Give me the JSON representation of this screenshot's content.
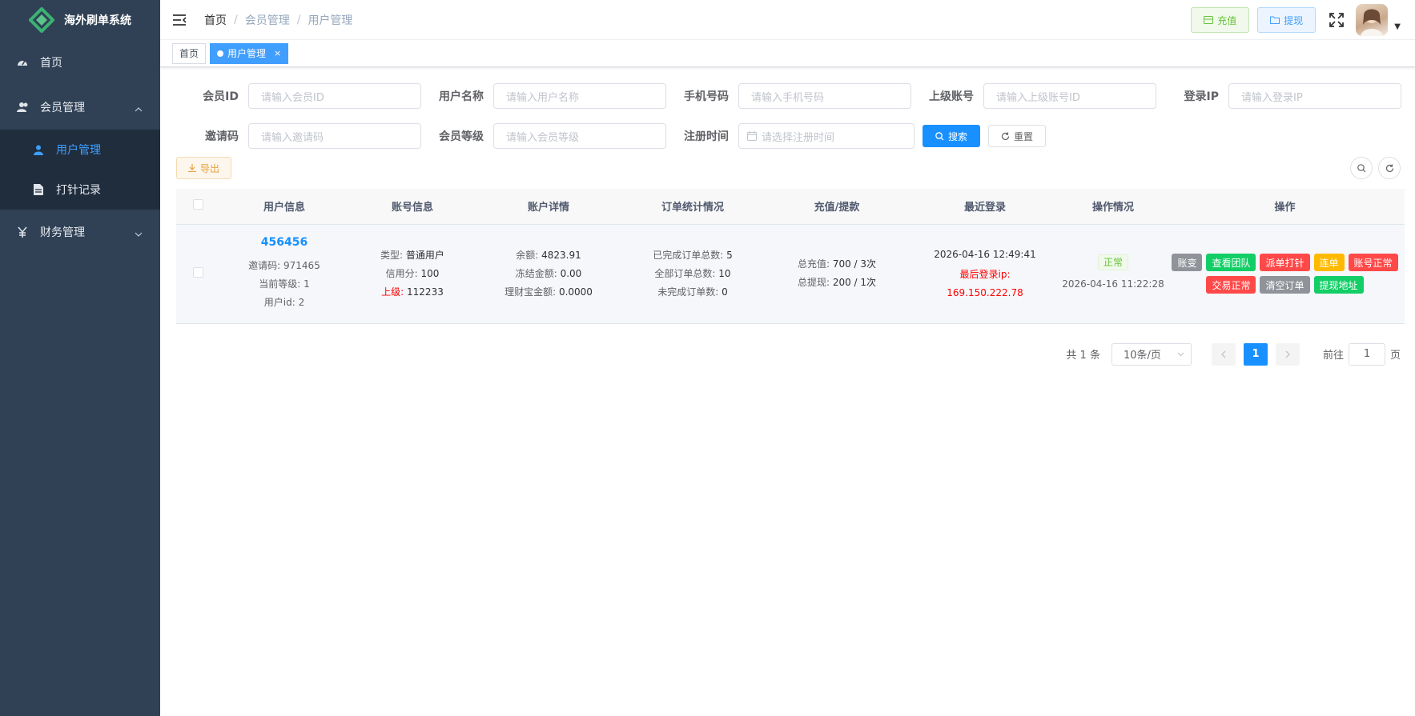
{
  "sidebar": {
    "logo_text": "海外刷单系统",
    "items": [
      {
        "label": "首页",
        "icon": "dashboard-icon"
      },
      {
        "label": "会员管理",
        "icon": "user-group-icon",
        "expanded": true,
        "children": [
          {
            "label": "用户管理",
            "icon": "user-icon",
            "active": true
          },
          {
            "label": "打针记录",
            "icon": "document-icon"
          }
        ]
      },
      {
        "label": "财务管理",
        "icon": "yen-icon"
      }
    ]
  },
  "navbar": {
    "breadcrumb": [
      "首页",
      "会员管理",
      "用户管理"
    ],
    "recharge_label": "充值",
    "withdraw_label": "提现"
  },
  "tags": [
    {
      "label": "首页"
    },
    {
      "label": "用户管理",
      "active": true,
      "close": "×"
    }
  ],
  "search": {
    "fields": [
      {
        "label": "会员ID",
        "placeholder": "请输入会员ID"
      },
      {
        "label": "用户名称",
        "placeholder": "请输入用户名称"
      },
      {
        "label": "手机号码",
        "placeholder": "请输入手机号码"
      },
      {
        "label": "上级账号",
        "placeholder": "请输入上级账号ID"
      },
      {
        "label": "登录IP",
        "placeholder": "请输入登录IP"
      },
      {
        "label": "邀请码",
        "placeholder": "请输入邀请码"
      },
      {
        "label": "会员等级",
        "placeholder": "请输入会员等级"
      },
      {
        "label": "注册时间",
        "placeholder": "请选择注册时间"
      }
    ],
    "search_label": "搜索",
    "reset_label": "重置"
  },
  "toolbar": {
    "export_label": "导出"
  },
  "table": {
    "headers": [
      "用户信息",
      "账号信息",
      "账户详情",
      "订单统计情况",
      "充值/提款",
      "最近登录",
      "操作情况",
      "操作"
    ],
    "rows": [
      {
        "user_id": "456456",
        "invite_code": "邀请码: 971465",
        "level": "当前等级: 1",
        "uid_line": "用户id: 2",
        "type_label": "类型:",
        "type_value": "普通用户",
        "credit_label": "信用分:",
        "credit_value": "100",
        "parent_label": "上级:",
        "parent_value": "112233",
        "balance_label": "余额:",
        "balance_value": "4823.91",
        "frozen_label": "冻结金额:",
        "frozen_value": "0.00",
        "wealth_label": "理财宝金额:",
        "wealth_value": "0.0000",
        "done_label": "已完成订单总数:",
        "done_value": "5",
        "all_label": "全部订单总数:",
        "all_value": "10",
        "undone_label": "未完成订单数:",
        "undone_value": "0",
        "recharge_label": "总充值:",
        "recharge_value": "700 / 3次",
        "withdraw_label": "总提现:",
        "withdraw_value": "200 / 1次",
        "last_login_time": "2026-04-16 12:49:41",
        "last_login_ip_label": "最后登录ip:",
        "last_login_ip": "169.150.222.78",
        "status": "正常",
        "status_time": "2026-04-16 11:22:28",
        "actions": [
          {
            "label": "账变",
            "color": "#909399"
          },
          {
            "label": "查看团队",
            "color": "#13ce66"
          },
          {
            "label": "派单打针",
            "color": "#ff4949"
          },
          {
            "label": "连单",
            "color": "#ffba00"
          },
          {
            "label": "账号正常",
            "color": "#ff4949"
          },
          {
            "label": "交易正常",
            "color": "#ff4949"
          },
          {
            "label": "清空订单",
            "color": "#909399"
          },
          {
            "label": "提现地址",
            "color": "#13ce66"
          }
        ]
      }
    ]
  },
  "pagination": {
    "total": "共 1 条",
    "page_size": "10条/页",
    "current": "1",
    "goto_prefix": "前往",
    "goto_value": "1",
    "goto_suffix": "页"
  }
}
